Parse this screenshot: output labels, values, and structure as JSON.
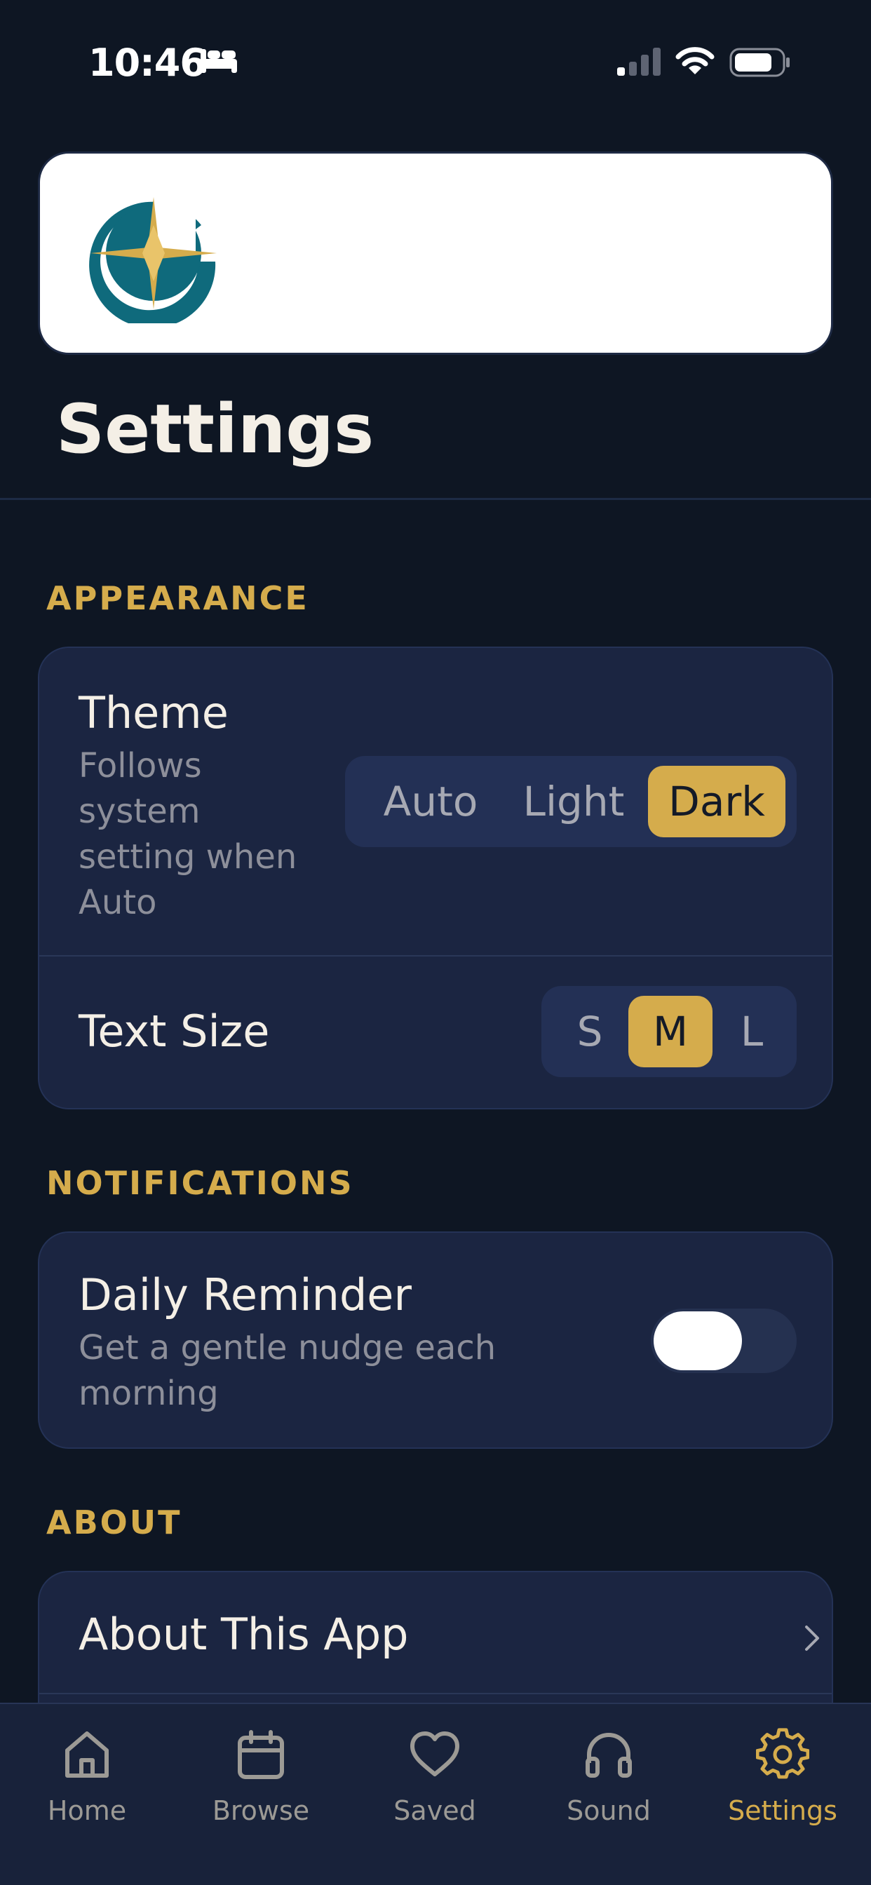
{
  "status_bar": {
    "time": "10:46"
  },
  "header": {
    "title": "Settings"
  },
  "appearance": {
    "section_label": "APPEARANCE",
    "theme": {
      "title": "Theme",
      "subtitle_lines": [
        "Follows",
        "system",
        "setting when",
        "Auto"
      ],
      "options": [
        "Auto",
        "Light",
        "Dark"
      ],
      "selected": "Dark"
    },
    "text_size": {
      "title": "Text Size",
      "options": [
        "S",
        "M",
        "L"
      ],
      "selected": "M"
    }
  },
  "notifications": {
    "section_label": "NOTIFICATIONS",
    "daily_reminder": {
      "title": "Daily Reminder",
      "subtitle_lines": [
        "Get a gentle nudge each",
        "morning"
      ],
      "enabled": false
    }
  },
  "about": {
    "section_label": "ABOUT",
    "about_item": {
      "title": "About This App"
    }
  },
  "tab_bar": {
    "tabs": [
      {
        "label": "Home",
        "icon": "home-icon"
      },
      {
        "label": "Browse",
        "icon": "calendar-icon"
      },
      {
        "label": "Saved",
        "icon": "heart-icon"
      },
      {
        "label": "Sound",
        "icon": "headphones-icon"
      },
      {
        "label": "Settings",
        "icon": "gear-icon"
      }
    ],
    "active": "Settings"
  },
  "colors": {
    "background": "#0e1623",
    "card": "#1b2541",
    "accent": "#d5ac4c",
    "logo_teal": "#0f6a7c"
  }
}
